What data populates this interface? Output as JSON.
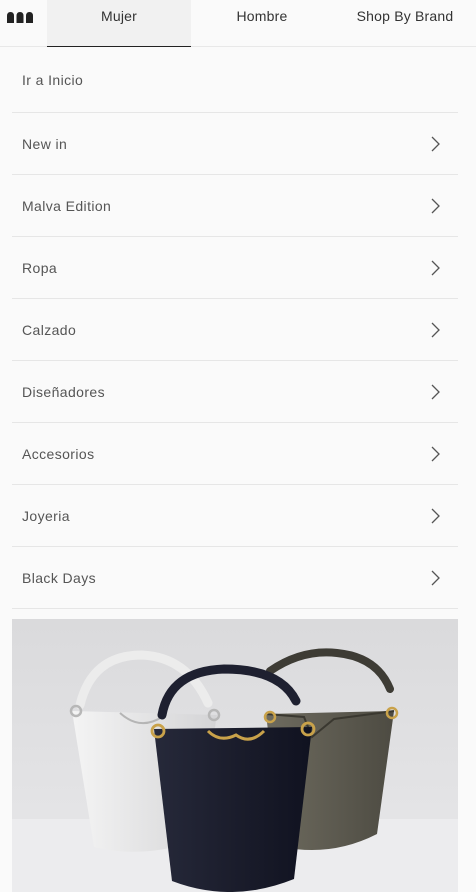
{
  "tabs": [
    {
      "label": "Mujer",
      "active": true
    },
    {
      "label": "Hombre",
      "active": false
    },
    {
      "label": "Shop By Brand",
      "active": false
    }
  ],
  "menu": [
    {
      "label": "Ir a Inicio",
      "has_chevron": false
    },
    {
      "label": "New in",
      "has_chevron": true
    },
    {
      "label": "Malva Edition",
      "has_chevron": true
    },
    {
      "label": "Ropa",
      "has_chevron": true
    },
    {
      "label": "Calzado",
      "has_chevron": true
    },
    {
      "label": "Diseñadores",
      "has_chevron": true
    },
    {
      "label": "Accesorios",
      "has_chevron": true
    },
    {
      "label": "Joyeria",
      "has_chevron": true
    },
    {
      "label": "Black Days",
      "has_chevron": true
    }
  ],
  "icons": {
    "brand": "brand-logo-icon",
    "chevron": "chevron-right-icon"
  },
  "colors": {
    "background": "#fafafa",
    "active_tab_underline": "#222222",
    "divider": "#e6e6e6",
    "text": "#555555"
  }
}
